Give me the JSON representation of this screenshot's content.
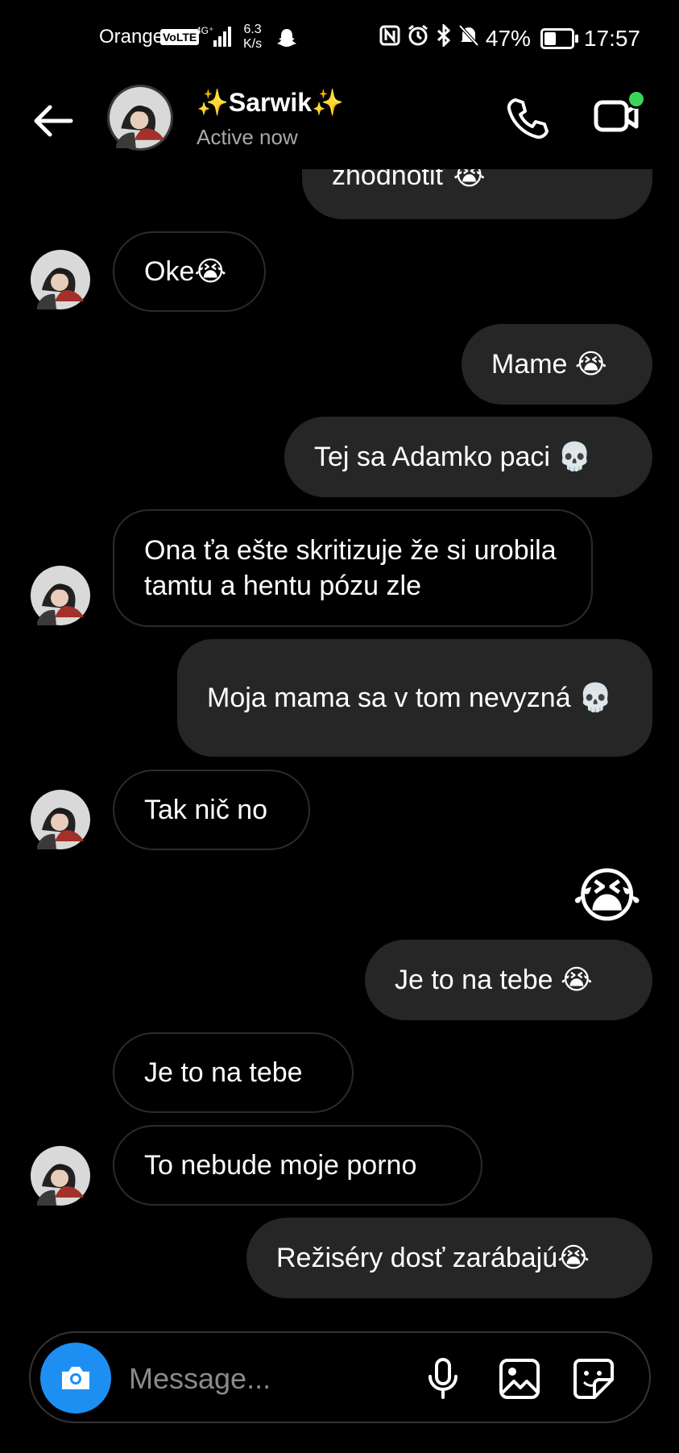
{
  "status_bar": {
    "carrier": "Orange",
    "volte": "VoLTE",
    "network": "4G⁺",
    "speed_value": "6.3",
    "speed_unit": "K/s",
    "battery": "47%",
    "time": "17:57"
  },
  "header": {
    "name": "✨Sarwik✨",
    "status": "Active now"
  },
  "messages": [
    {
      "dir": "out",
      "text": "zhodnotiť 😭"
    },
    {
      "dir": "in",
      "text": "Oke😭"
    },
    {
      "dir": "out",
      "text": "Mame 😭"
    },
    {
      "dir": "out",
      "text": "Tej sa Adamko paci 💀"
    },
    {
      "dir": "in",
      "text": "Ona ťa ešte skritizuje že si urobila tamtu a hentu pózu zle"
    },
    {
      "dir": "out",
      "text": "Moja mama sa v tom nevyzná 💀"
    },
    {
      "dir": "in",
      "text": "Tak nič no"
    },
    {
      "dir": "out",
      "text": "😭"
    },
    {
      "dir": "out",
      "text": "Je to na tebe 😭"
    },
    {
      "dir": "in",
      "text": "Je to na tebe"
    },
    {
      "dir": "in",
      "text": "To nebude moje porno"
    },
    {
      "dir": "out",
      "text": "Režiséry dosť zarábajú😭"
    }
  ],
  "composer": {
    "placeholder": "Message..."
  },
  "colors": {
    "background": "#000000",
    "outgoing_bubble": "#262626",
    "incoming_border": "#2b2b2b",
    "camera_button": "#1d8ff2",
    "online_dot": "#3ad65a"
  }
}
